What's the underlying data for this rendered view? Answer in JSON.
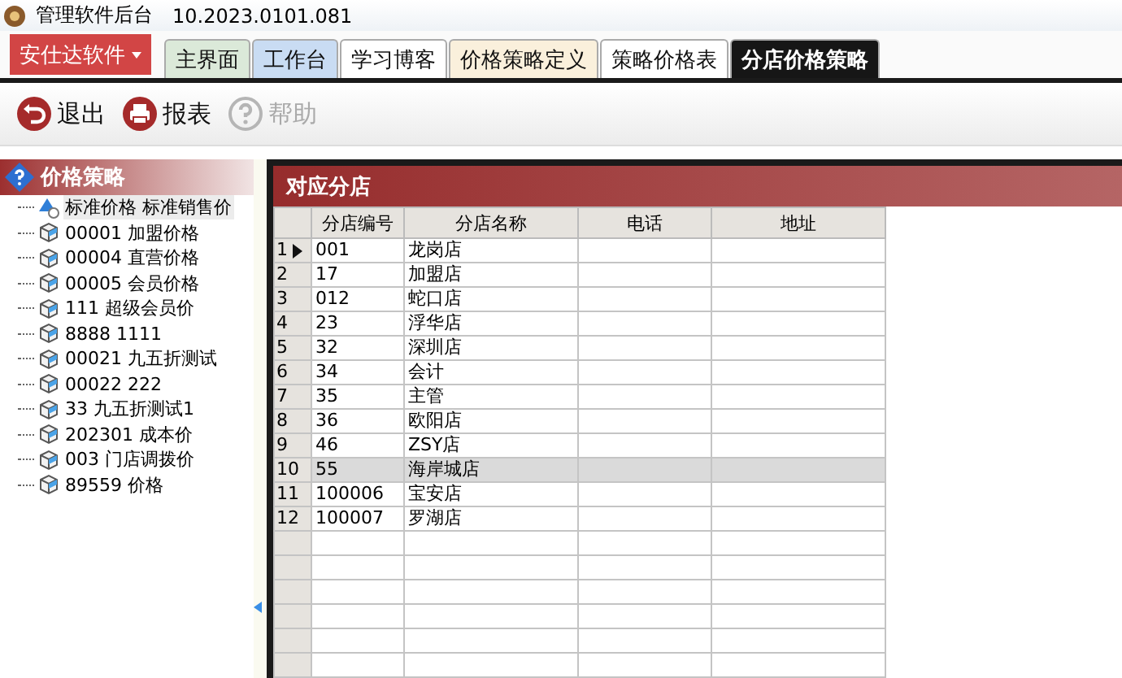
{
  "window": {
    "title": "管理软件后台",
    "version": "10.2023.0101.081"
  },
  "menu_button": {
    "label": "安仕达软件"
  },
  "tabs": [
    {
      "label": "主界面",
      "selected": false,
      "color": "#dbe9d9"
    },
    {
      "label": "工作台",
      "selected": false,
      "color": "#c9dcf3"
    },
    {
      "label": "学习博客",
      "selected": false,
      "color": "#ffffff"
    },
    {
      "label": "价格策略定义",
      "selected": false,
      "color": "#faf0dc"
    },
    {
      "label": "策略价格表",
      "selected": false,
      "color": "#ffffff"
    },
    {
      "label": "分店价格策略",
      "selected": true,
      "color": "#161616"
    }
  ],
  "toolbar": [
    {
      "label": "退出",
      "kind": "exit",
      "disabled": false
    },
    {
      "label": "报表",
      "kind": "print",
      "disabled": false
    },
    {
      "label": "帮助",
      "kind": "help",
      "disabled": true
    }
  ],
  "sidebar": {
    "title": "价格策略",
    "items": [
      {
        "label": "标准价格  标准销售价",
        "kind": "standard",
        "selected": true
      },
      {
        "label": "00001  加盟价格",
        "kind": "strategy",
        "selected": false
      },
      {
        "label": "00004  直营价格",
        "kind": "strategy",
        "selected": false
      },
      {
        "label": "00005  会员价格",
        "kind": "strategy",
        "selected": false
      },
      {
        "label": "111  超级会员价",
        "kind": "strategy",
        "selected": false
      },
      {
        "label": "8888  1111",
        "kind": "strategy",
        "selected": false
      },
      {
        "label": "00021  九五折测试",
        "kind": "strategy",
        "selected": false
      },
      {
        "label": "00022  222",
        "kind": "strategy",
        "selected": false
      },
      {
        "label": "33  九五折测试1",
        "kind": "strategy",
        "selected": false
      },
      {
        "label": "202301  成本价",
        "kind": "strategy",
        "selected": false
      },
      {
        "label": "003  门店调拨价",
        "kind": "strategy",
        "selected": false
      },
      {
        "label": "89559  价格",
        "kind": "strategy",
        "selected": false
      }
    ]
  },
  "panel": {
    "title": "对应分店",
    "table": {
      "columns": [
        "分店编号",
        "分店名称",
        "电话",
        "地址"
      ],
      "rows": [
        {
          "num": "1",
          "cells": [
            "001",
            "龙岗店",
            "",
            ""
          ],
          "current": true,
          "selected": false
        },
        {
          "num": "2",
          "cells": [
            "17",
            "加盟店",
            "",
            ""
          ],
          "current": false,
          "selected": false
        },
        {
          "num": "3",
          "cells": [
            "012",
            "蛇口店",
            "",
            ""
          ],
          "current": false,
          "selected": false
        },
        {
          "num": "4",
          "cells": [
            "23",
            "浮华店",
            "",
            ""
          ],
          "current": false,
          "selected": false
        },
        {
          "num": "5",
          "cells": [
            "32",
            "深圳店",
            "",
            ""
          ],
          "current": false,
          "selected": false
        },
        {
          "num": "6",
          "cells": [
            "34",
            "会计",
            "",
            ""
          ],
          "current": false,
          "selected": false
        },
        {
          "num": "7",
          "cells": [
            "35",
            "主管",
            "",
            ""
          ],
          "current": false,
          "selected": false
        },
        {
          "num": "8",
          "cells": [
            "36",
            "欧阳店",
            "",
            ""
          ],
          "current": false,
          "selected": false
        },
        {
          "num": "9",
          "cells": [
            "46",
            "ZSY店",
            "",
            ""
          ],
          "current": false,
          "selected": false
        },
        {
          "num": "10",
          "cells": [
            "55",
            "海岸城店",
            "",
            ""
          ],
          "current": false,
          "selected": true
        },
        {
          "num": "11",
          "cells": [
            "100006",
            "宝安店",
            "",
            ""
          ],
          "current": false,
          "selected": false
        },
        {
          "num": "12",
          "cells": [
            "100007",
            "罗湖店",
            "",
            ""
          ],
          "current": false,
          "selected": false
        }
      ]
    }
  }
}
